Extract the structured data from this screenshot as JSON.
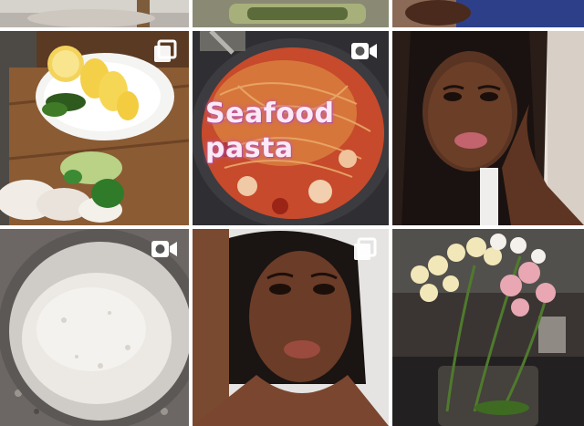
{
  "grid": {
    "tiles": [
      {
        "id": "top-left-partial",
        "media": "photo",
        "icon": "none"
      },
      {
        "id": "top-middle-partial",
        "media": "photo",
        "icon": "none"
      },
      {
        "id": "top-right-partial",
        "media": "photo",
        "icon": "none"
      },
      {
        "id": "lemons-herbs-onions",
        "media": "carousel",
        "icon": "multiple-photos-icon"
      },
      {
        "id": "seafood-pasta",
        "media": "video",
        "icon": "video-camera-icon",
        "caption": "Seafood\npasta"
      },
      {
        "id": "selfie-long-hair",
        "media": "photo",
        "icon": "none"
      },
      {
        "id": "flour-bowl",
        "media": "video",
        "icon": "video-camera-icon"
      },
      {
        "id": "bob-haircut-portrait",
        "media": "carousel",
        "icon": "multiple-photos-icon"
      },
      {
        "id": "orchids",
        "media": "photo",
        "icon": "none"
      }
    ]
  },
  "colors": {
    "caption_text": "#fbe9f6",
    "caption_glow": "#c45aa5",
    "icon_white": "#ffffff"
  }
}
